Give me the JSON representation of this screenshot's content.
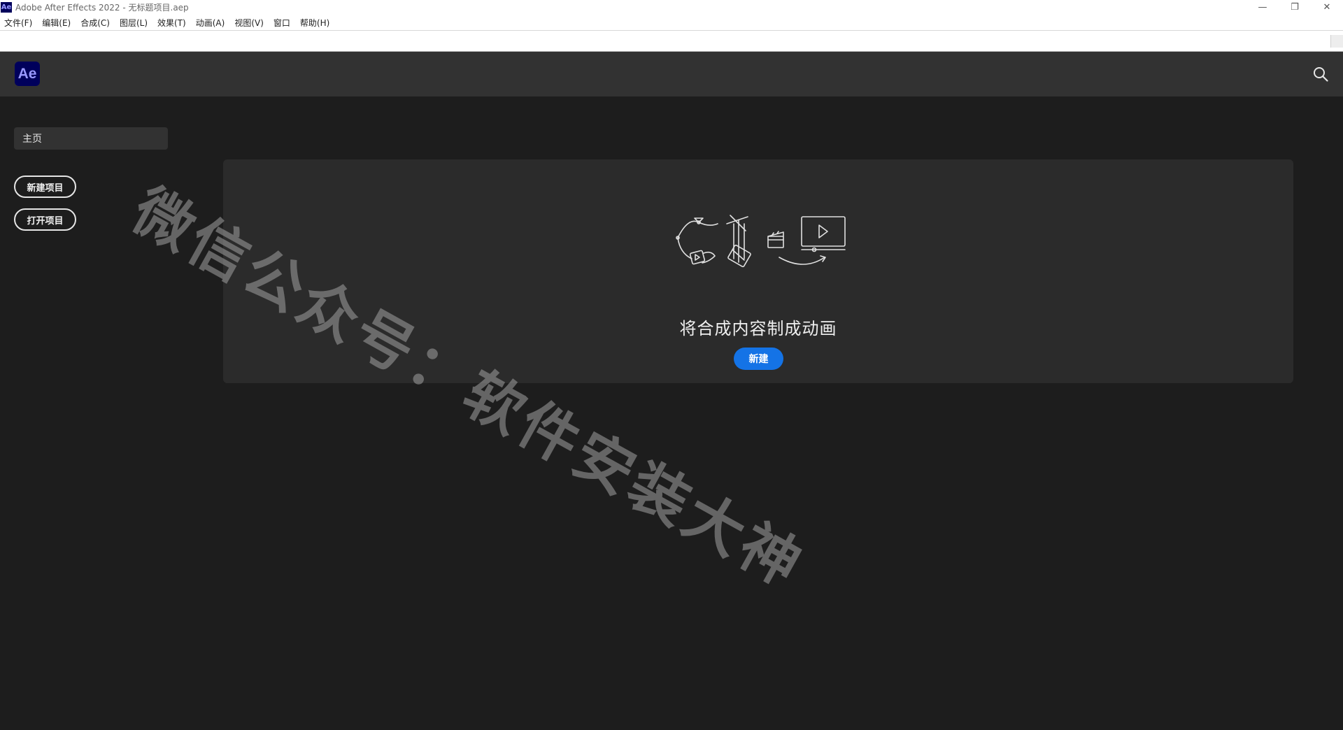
{
  "window": {
    "app_badge": "Ae",
    "title": "Adobe After Effects 2022 - 无标题项目.aep",
    "controls": {
      "minimize": "—",
      "restore": "❐",
      "close": "✕"
    }
  },
  "menubar": {
    "items": [
      {
        "label": "文件(F)"
      },
      {
        "label": "编辑(E)"
      },
      {
        "label": "合成(C)"
      },
      {
        "label": "图层(L)"
      },
      {
        "label": "效果(T)"
      },
      {
        "label": "动画(A)"
      },
      {
        "label": "视图(V)"
      },
      {
        "label": "窗口"
      },
      {
        "label": "帮助(H)"
      }
    ]
  },
  "header": {
    "logo_text": "Ae",
    "search_icon": "search-icon"
  },
  "sidebar": {
    "home_label": "主页",
    "new_project_label": "新建项目",
    "open_project_label": "打开项目"
  },
  "hero": {
    "heading": "将合成内容制成动画",
    "new_button_label": "新建",
    "illustration": "animation-workflow-illustration"
  },
  "watermark": {
    "text": "微信公众号：软件安装大神"
  },
  "colors": {
    "background": "#1d1d1d",
    "header": "#323232",
    "card": "#2b2b2b",
    "accent_blue": "#1473e6",
    "ae_logo_bg": "#00005b",
    "ae_logo_text": "#9999ff"
  }
}
